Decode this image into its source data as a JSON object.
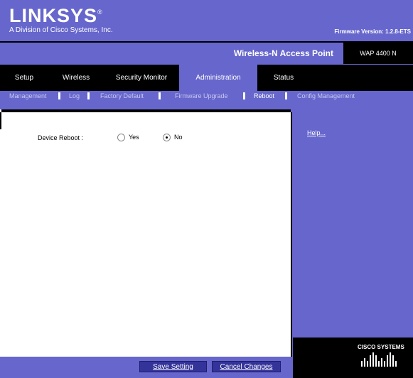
{
  "header": {
    "brand": "LINKSYS",
    "brand_mark": "®",
    "tagline": "A Division of Cisco Systems, Inc.",
    "firmware": "Firmware Version: 1.2.8-ETS"
  },
  "product": {
    "name": "Wireless-N Access Point",
    "model": "WAP 4400 N"
  },
  "tabs": [
    {
      "label": "Setup",
      "active": false
    },
    {
      "label": "Wireless",
      "active": false
    },
    {
      "label": "Security Monitor",
      "active": false
    },
    {
      "label": "Administration",
      "active": true
    },
    {
      "label": "Status",
      "active": false
    }
  ],
  "subtabs": [
    {
      "label": "Management",
      "active": false
    },
    {
      "label": "Log",
      "active": false
    },
    {
      "label": "Factory Default",
      "active": false
    },
    {
      "label": "Firmware Upgrade",
      "active": false
    },
    {
      "label": "Reboot",
      "active": true
    },
    {
      "label": "Config Management",
      "active": false
    }
  ],
  "reboot": {
    "label": "Device Reboot :",
    "options": [
      {
        "label": "Yes",
        "selected": false
      },
      {
        "label": "No",
        "selected": true
      }
    ]
  },
  "help": {
    "label": "Help..."
  },
  "footer": {
    "save_label": "Save Setting",
    "cancel_label": "Cancel Changes"
  },
  "cisco": {
    "wordmark": "CISCO SYSTEMS"
  },
  "colors": {
    "accent": "#6666cc",
    "dark": "#000000",
    "button": "#33339a"
  }
}
